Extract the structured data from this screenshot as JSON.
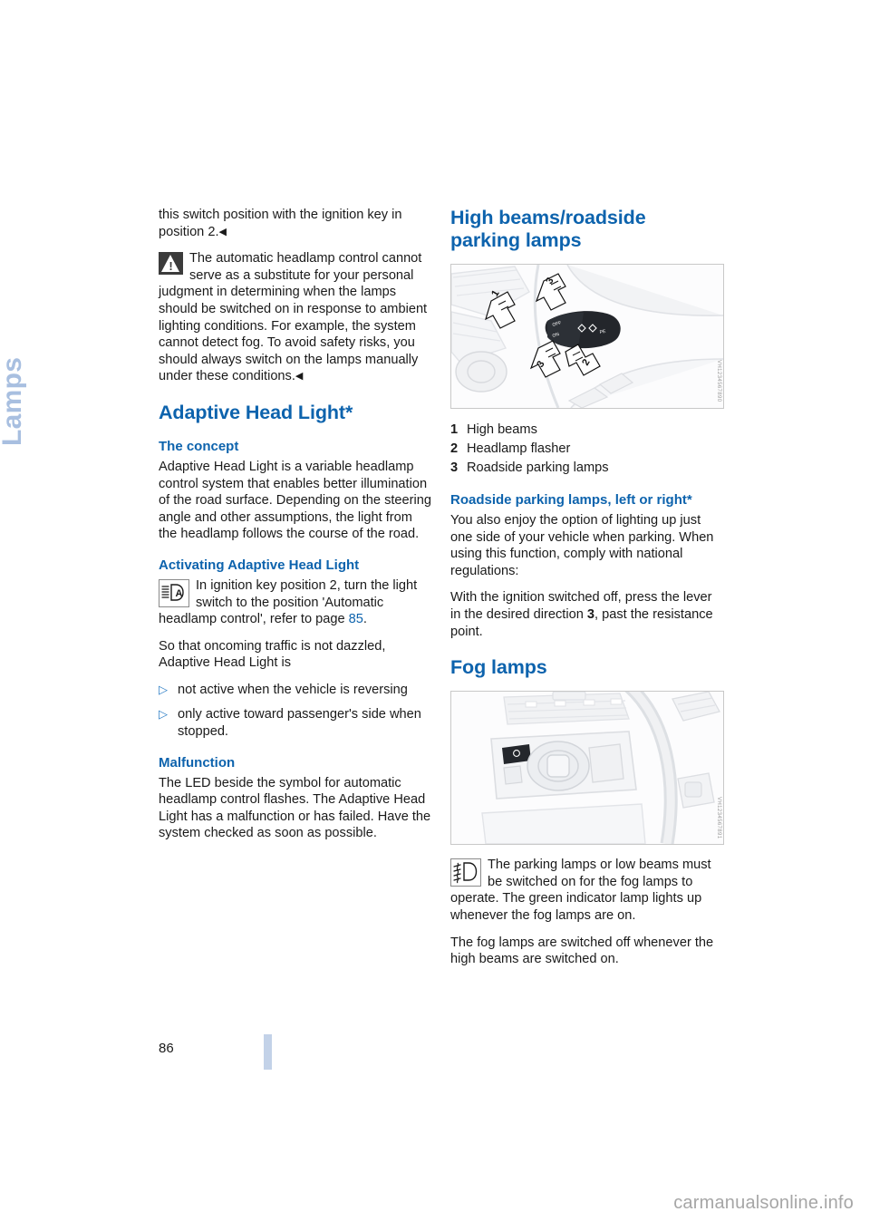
{
  "chapter": {
    "tab_label": "Lamps"
  },
  "page": {
    "number": "86",
    "watermark": "carmanualsonline.info"
  },
  "left_column": {
    "continued_paragraph": "this switch position with the ignition key in position 2.",
    "warning_note": {
      "icon": "warning-triangle-icon",
      "text": "The automatic headlamp control cannot serve as a substitute for your personal judgment in determining when the lamps should be switched on in response to ambient lighting conditions. For example, the system cannot detect fog. To avoid safety risks, you should always switch on the lamps manually under these conditions."
    },
    "section_title": "Adaptive Head Light*",
    "concept": {
      "heading": "The concept",
      "body": "Adaptive Head Light is a variable headlamp control system that enables better illumination of the road surface. Depending on the steering angle and other assumptions, the light from the headlamp follows the course of the road."
    },
    "activating": {
      "heading": "Activating Adaptive Head Light",
      "icon": "automatic-headlamp-control-icon",
      "body_part1": "In ignition key position 2, turn the light switch to the position 'Automatic headlamp control', refer to page ",
      "page_ref": "85",
      "body_part2": ".",
      "intro": "So that oncoming traffic is not dazzled, Adaptive Head Light is",
      "bullets": [
        "not active when the vehicle is reversing",
        "only active toward passenger's side when stopped."
      ]
    },
    "malfunction": {
      "heading": "Malfunction",
      "body": "The LED beside the symbol for automatic headlamp control flashes. The Adaptive Head Light has a malfunction or has failed. Have the system checked as soon as possible."
    }
  },
  "right_column": {
    "high_beams_section": {
      "title_line1": "High beams/roadside",
      "title_line2": "parking lamps",
      "figure": {
        "name": "steering-column-stalk-illustration",
        "code": "VH1234567890"
      },
      "legend": [
        {
          "num": "1",
          "label": "High beams"
        },
        {
          "num": "2",
          "label": "Headlamp flasher"
        },
        {
          "num": "3",
          "label": "Roadside parking lamps"
        }
      ]
    },
    "roadside_parking": {
      "heading": "Roadside parking lamps, left or right*",
      "para1": "You also enjoy the option of lighting up just one side of your vehicle when parking. When using this function, comply with national regulations:",
      "para2_part1": "With the ignition switched off, press the lever in the desired direction ",
      "para2_bold": "3",
      "para2_part2": ", past the resistance point."
    },
    "fog_lamps": {
      "title": "Fog lamps",
      "figure": {
        "name": "light-switch-panel-illustration",
        "code": "VH1234567891"
      },
      "note": {
        "icon": "fog-lamp-icon",
        "text": "The parking lamps or low beams must be switched on for the fog lamps to operate. The green indicator lamp lights up whenever the fog lamps are on."
      },
      "para": "The fog lamps are switched off whenever the high beams are switched on."
    }
  },
  "colors": {
    "heading_blue": "#0d63ad",
    "tab_blue": "#a8bfe0",
    "bar_blue": "#c3d2e8",
    "body_text": "#1a1a1a"
  }
}
